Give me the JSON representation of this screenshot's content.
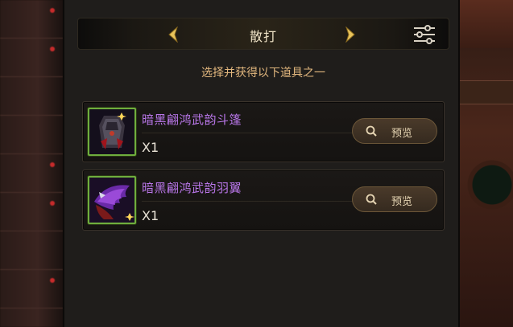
{
  "header": {
    "mode_title": "散打",
    "subtitle": "选择并获得以下道具之一"
  },
  "items": [
    {
      "name": "暗黑翩鸿武韵斗篷",
      "quantity": "X1",
      "preview_label": "预览",
      "icon": "cloak-icon"
    },
    {
      "name": "暗黑翩鸿武韵羽翼",
      "quantity": "X1",
      "preview_label": "预览",
      "icon": "wings-icon"
    }
  ],
  "colors": {
    "item_name": "#b876e8",
    "subtitle": "#e2b77e",
    "arrow": "#e8c35a",
    "icon_border": "#6fae3d"
  }
}
